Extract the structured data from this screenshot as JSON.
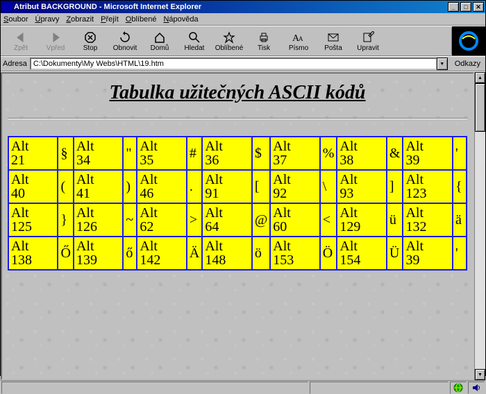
{
  "window": {
    "title": "Atribut BACKGROUND - Microsoft Internet Explorer"
  },
  "menu": {
    "soubor": "Soubor",
    "upravy": "Úpravy",
    "zobrazit": "Zobrazit",
    "prejit": "Přejít",
    "oblibene": "Oblíbené",
    "napoveda": "Nápověda"
  },
  "toolbar": {
    "zpet": "Zpět",
    "vpred": "Vpřed",
    "stop": "Stop",
    "obnovit": "Obnovit",
    "domu": "Domů",
    "hledat": "Hledat",
    "oblibene": "Oblíbené",
    "tisk": "Tisk",
    "pismo": "Písmo",
    "posta": "Pošta",
    "upravit": "Upravit"
  },
  "address": {
    "label": "Adresa",
    "value": "C:\\Dokumenty\\My Webs\\HTML\\19.htm",
    "links": "Odkazy"
  },
  "page": {
    "heading": "Tabulka užitečných ASCII kódů"
  },
  "table": {
    "rows": [
      [
        {
          "code": "Alt 21",
          "char": "§"
        },
        {
          "code": "Alt 34",
          "char": "\""
        },
        {
          "code": "Alt 35",
          "char": "#"
        },
        {
          "code": "Alt 36",
          "char": "$"
        },
        {
          "code": "Alt 37",
          "char": "%"
        },
        {
          "code": "Alt 38",
          "char": "&"
        },
        {
          "code": "Alt 39",
          "char": "'"
        }
      ],
      [
        {
          "code": "Alt 40",
          "char": "("
        },
        {
          "code": "Alt 41",
          "char": ")"
        },
        {
          "code": "Alt 46",
          "char": "."
        },
        {
          "code": "Alt 91",
          "char": "["
        },
        {
          "code": "Alt 92",
          "char": "\\"
        },
        {
          "code": "Alt 93",
          "char": "]"
        },
        {
          "code": "Alt 123",
          "char": "{"
        }
      ],
      [
        {
          "code": "Alt 125",
          "char": "}"
        },
        {
          "code": "Alt 126",
          "char": "~"
        },
        {
          "code": "Alt 62",
          "char": ">"
        },
        {
          "code": "Alt 64",
          "char": "@"
        },
        {
          "code": "Alt 60",
          "char": "<"
        },
        {
          "code": "Alt 129",
          "char": "ü"
        },
        {
          "code": "Alt 132",
          "char": "ä"
        }
      ],
      [
        {
          "code": "Alt 138",
          "char": "Ő"
        },
        {
          "code": "Alt 139",
          "char": "ő"
        },
        {
          "code": "Alt 142",
          "char": "Ä"
        },
        {
          "code": "Alt 148",
          "char": "ö"
        },
        {
          "code": "Alt 153",
          "char": "Ö"
        },
        {
          "code": "Alt 154",
          "char": "Ü"
        },
        {
          "code": "Alt 39",
          "char": "'"
        }
      ]
    ]
  }
}
